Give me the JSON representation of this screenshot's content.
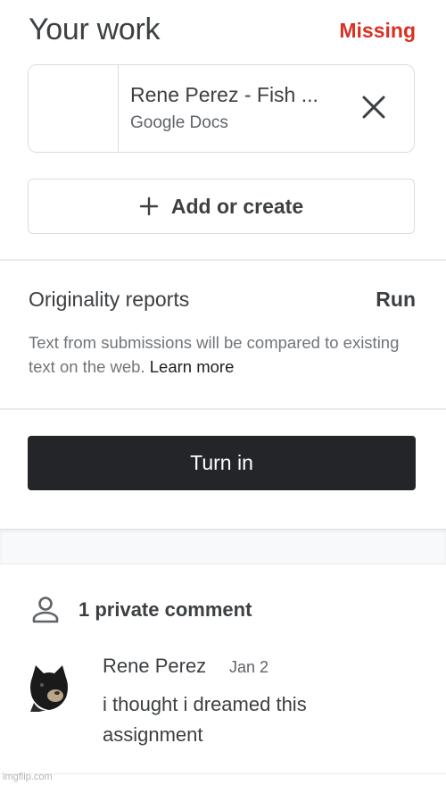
{
  "work": {
    "title": "Your work",
    "status": "Missing",
    "attachment": {
      "title": "Rene Perez - Fish ...",
      "type": "Google Docs",
      "remove_icon": "close-icon"
    },
    "add_create_label": "Add or create",
    "add_icon": "plus-icon"
  },
  "originality": {
    "title": "Originality reports",
    "run_label": "Run",
    "description": "Text from submissions will be compared to existing text on the web.",
    "learn_more": "Learn more"
  },
  "turn_in_label": "Turn in",
  "comments": {
    "header_icon": "person-icon",
    "header_label": "1 private comment",
    "items": [
      {
        "author": "Rene Perez",
        "date": "Jan 2",
        "text": "i thought i dreamed this assignment"
      }
    ]
  },
  "watermark": "imgflip.com",
  "colors": {
    "missing": "#d93025",
    "turn_in_bg": "#232529",
    "border": "#dadce0"
  }
}
